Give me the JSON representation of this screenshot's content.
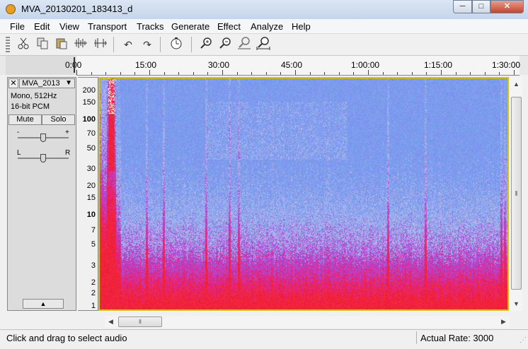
{
  "window": {
    "title": "MVA_20130201_183413_d",
    "minimize_label": "─",
    "maximize_label": "□",
    "close_label": "✕"
  },
  "menu": [
    "File",
    "Edit",
    "View",
    "Transport",
    "Tracks",
    "Generate",
    "Effect",
    "Analyze",
    "Help"
  ],
  "toolbar": {
    "buttons": [
      "cut-icon",
      "copy-icon",
      "paste-icon",
      "trim-icon",
      "silence-icon",
      "undo-icon",
      "redo-icon",
      "sync-lock-icon",
      "zoom-in-icon",
      "zoom-out-icon",
      "fit-selection-icon",
      "fit-project-icon"
    ],
    "glyphs": {
      "undo": "↶",
      "redo": "↷",
      "zoom_in": "⊕",
      "zoom_out": "⊖"
    }
  },
  "ruler": {
    "labels": [
      "0:00",
      "15:00",
      "30:00",
      "45:00",
      "1:00:00",
      "1:15:00",
      "1:30:00"
    ]
  },
  "track": {
    "name": "MVA_2013",
    "close_glyph": "✕",
    "menu_arrow": "▼",
    "info_line1": "Mono, 512Hz",
    "info_line2": "16-bit PCM",
    "mute_label": "Mute",
    "solo_label": "Solo",
    "gain_minus": "-",
    "gain_plus": "+",
    "pan_left": "L",
    "pan_right": "R",
    "collapse_glyph": "▲"
  },
  "freq_axis": {
    "labels": [
      "200",
      "150",
      "100",
      "70",
      "50",
      "30",
      "20",
      "15",
      "10",
      "7",
      "5",
      "3",
      "2",
      "2",
      "1"
    ],
    "bold": [
      "100",
      "10"
    ]
  },
  "spectrogram": {
    "colors": {
      "background": "#7f9be8",
      "low": "#9bb0f0",
      "mid": "#b050d8",
      "high": "#e8204a",
      "hot": "#ff2030",
      "selection_border": "#d8c400"
    }
  },
  "scroll": {
    "up": "▲",
    "down": "▼",
    "left": "◀",
    "right": "▶",
    "grip": "⦀"
  },
  "status": {
    "left": "Click and drag to select audio",
    "right": "Actual Rate: 3000"
  }
}
